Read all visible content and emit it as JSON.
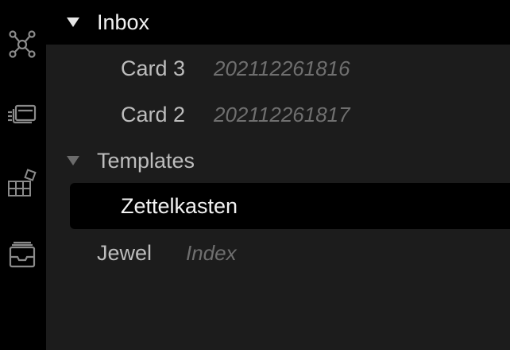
{
  "rail": {
    "icons": [
      "graph-icon",
      "cards-icon",
      "tiles-icon",
      "archive-icon"
    ]
  },
  "tree": {
    "inbox": {
      "label": "Inbox",
      "items": [
        {
          "title": "Card 3",
          "id": "202112261816"
        },
        {
          "title": "Card 2",
          "id": "202112261817"
        }
      ]
    },
    "templates": {
      "label": "Templates",
      "items": [
        {
          "title": "Zettelkasten"
        }
      ]
    },
    "jewel": {
      "title": "Jewel",
      "meta": "Index"
    }
  }
}
